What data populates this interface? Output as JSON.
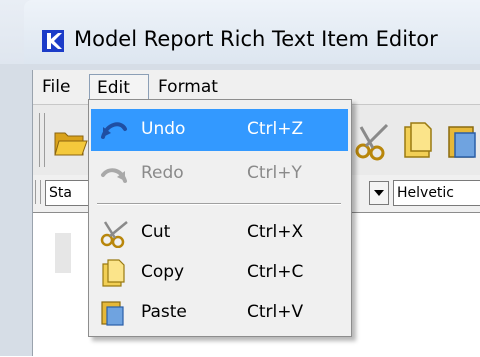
{
  "window": {
    "title": "Model Report Rich Text Item Editor"
  },
  "menubar": {
    "items": [
      "File",
      "Edit",
      "Format"
    ]
  },
  "format_toolbar": {
    "style_combo_value": "Sta",
    "font_combo_value": "Helvetic"
  },
  "edit_menu": {
    "items": [
      {
        "label": "Undo",
        "accel": "Ctrl+Z",
        "icon": "undo-icon",
        "state": "highlighted"
      },
      {
        "label": "Redo",
        "accel": "Ctrl+Y",
        "icon": "redo-icon",
        "state": "disabled"
      },
      {
        "label": "Cut",
        "accel": "Ctrl+X",
        "icon": "scissors-icon",
        "state": "enabled"
      },
      {
        "label": "Copy",
        "accel": "Ctrl+C",
        "icon": "copy-icon",
        "state": "enabled"
      },
      {
        "label": "Paste",
        "accel": "Ctrl+V",
        "icon": "paste-icon",
        "state": "enabled"
      }
    ]
  },
  "colors": {
    "highlight": "#3399ff",
    "app_icon": "#1c3cc8"
  }
}
